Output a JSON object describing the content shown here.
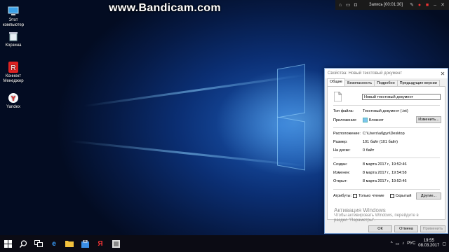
{
  "watermark": "www.Bandicam.com",
  "recorder": {
    "status": "Запись [00:01:30]"
  },
  "desktop_icons": [
    {
      "label": "Этот компьютер",
      "icon": "computer-icon"
    },
    {
      "label": "Корзина",
      "icon": "recycle-bin-icon"
    },
    {
      "label": "Коннект Менеджер",
      "icon": "connect-manager-icon"
    },
    {
      "label": "Yandex",
      "icon": "yandex-browser-icon"
    }
  ],
  "dialog": {
    "title": "Свойства: Новый текстовый документ",
    "tabs": [
      "Общие",
      "Безопасность",
      "Подробно",
      "Предыдущие версии"
    ],
    "file_name": "Новый текстовый документ",
    "type_label": "Тип файла:",
    "type_value": "Текстовый документ (.txt)",
    "app_label": "Приложение:",
    "app_value": "Блокнот",
    "change_button": "Изменить...",
    "location_label": "Расположение:",
    "location_value": "C:\\Users\\абдул\\Desktop",
    "size_label": "Размер:",
    "size_value": "101 байт (101 байт)",
    "disk_label": "На диске:",
    "disk_value": "0 байт",
    "created_label": "Создан:",
    "created_value": "8 марта 2017 г., 19:52:46",
    "modified_label": "Изменен:",
    "modified_value": "8 марта 2017 г., 19:54:58",
    "opened_label": "Открыт:",
    "opened_value": "8 марта 2017 г., 19:52:46",
    "attributes_label": "Атрибуты:",
    "readonly_label": "Только чтение",
    "hidden_label": "Скрытый",
    "other_button": "Другие...",
    "ok_button": "ОК",
    "cancel_button": "Отмена",
    "apply_button": "Применить"
  },
  "activation": {
    "title": "Активация Windows",
    "line1": "Чтобы активировать Windows, перейдите в",
    "line2": "раздел \"Параметры\"."
  },
  "taskbar": {
    "language": "РУС",
    "time": "19:55",
    "date": "08.03.2017"
  }
}
